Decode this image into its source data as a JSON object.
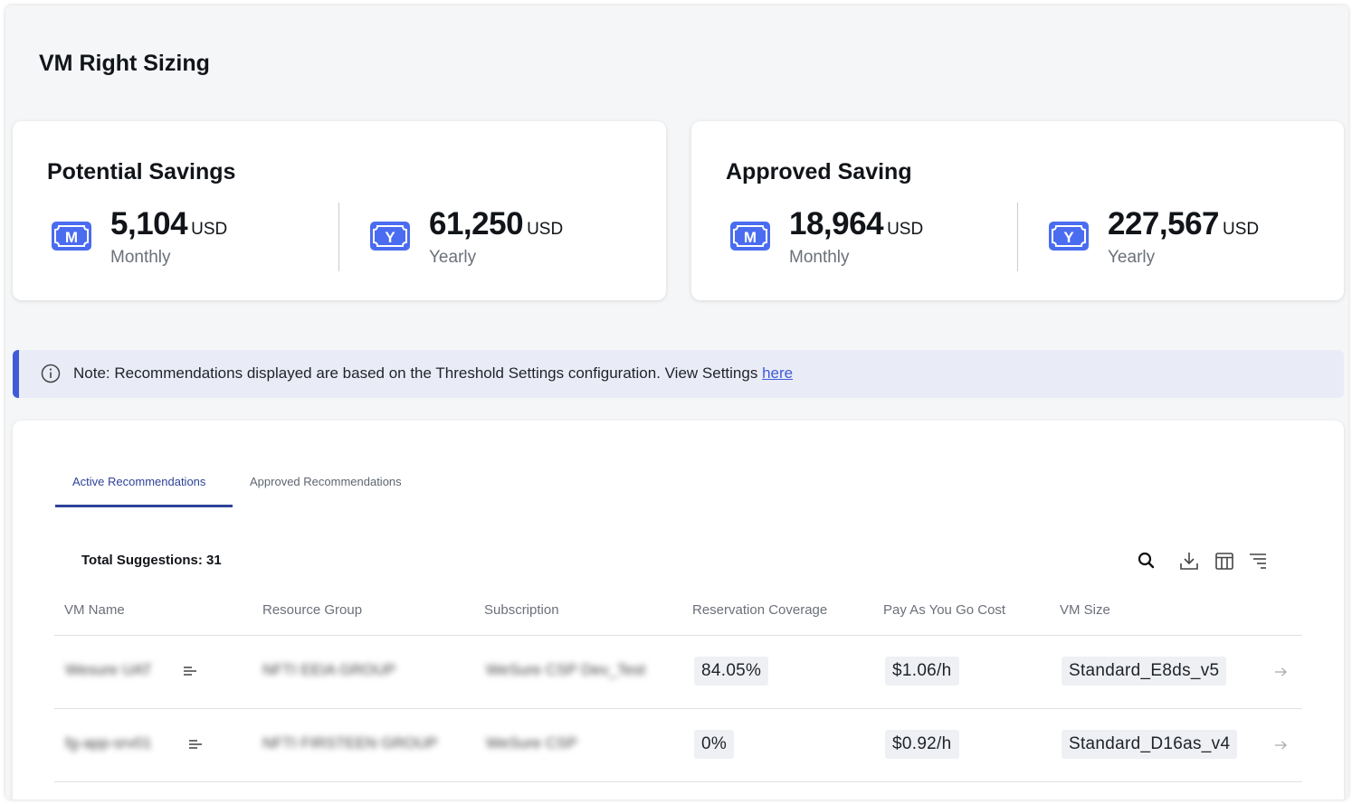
{
  "page": {
    "title": "VM Right Sizing"
  },
  "cards": [
    {
      "title": "Potential Savings",
      "metrics": [
        {
          "badge_letter": "M",
          "value": "5,104",
          "unit": "USD",
          "period": "Monthly"
        },
        {
          "badge_letter": "Y",
          "value": "61,250",
          "unit": "USD",
          "period": "Yearly"
        }
      ]
    },
    {
      "title": "Approved Saving",
      "metrics": [
        {
          "badge_letter": "M",
          "value": "18,964",
          "unit": "USD",
          "period": "Monthly"
        },
        {
          "badge_letter": "Y",
          "value": "227,567",
          "unit": "USD",
          "period": "Yearly"
        }
      ]
    }
  ],
  "note": {
    "text": "Note: Recommendations displayed are based on the Threshold Settings configuration. View Settings ",
    "link": "here"
  },
  "tabs": [
    {
      "label": "Active Recommendations",
      "active": true
    },
    {
      "label": "Approved Recommendations",
      "active": false
    }
  ],
  "table": {
    "total_label": "Total Suggestions: 31",
    "toolbar_icons": [
      "search-icon",
      "download-icon",
      "columns-icon",
      "filter-list-icon"
    ],
    "columns": [
      "VM Name",
      "Resource Group",
      "Subscription",
      "Reservation Coverage",
      "Pay As You Go Cost",
      "VM Size"
    ],
    "rows": [
      {
        "vm_name": "Wesure UAT",
        "resource_group": "NFTI EEIA GROUP",
        "subscription": "WeSure CSP Dev_Test",
        "coverage": "84.05%",
        "cost": "$1.06/h",
        "vm_size": "Standard_E8ds_v5"
      },
      {
        "vm_name": "fg-app-srv01",
        "resource_group": "NFTI FIRSTEEN GROUP",
        "subscription": "WeSure CSP",
        "coverage": "0%",
        "cost": "$0.92/h",
        "vm_size": "Standard_D16as_v4"
      }
    ]
  },
  "colors": {
    "accent": "#3f5bd8",
    "tab_active": "#2d4399",
    "note_bg": "#e9ecf7"
  }
}
